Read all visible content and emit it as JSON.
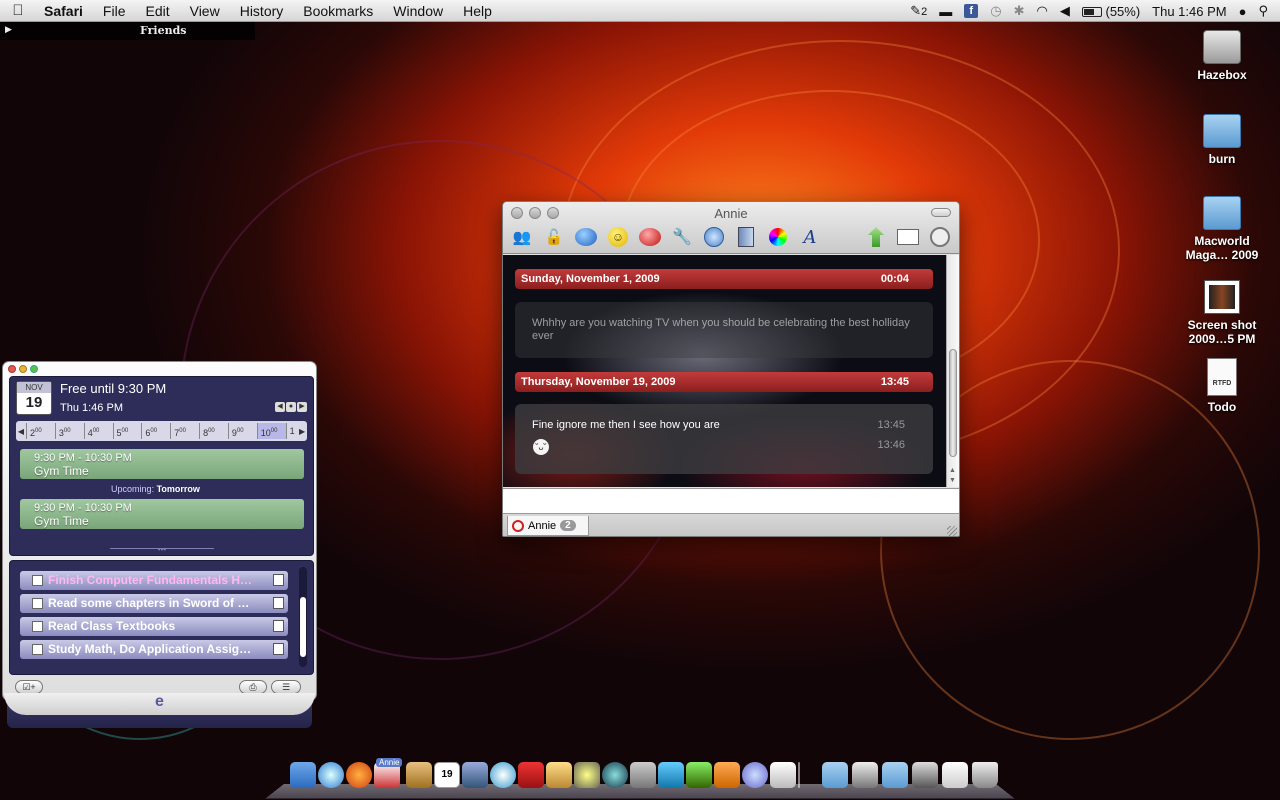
{
  "menubar": {
    "app_name": "Safari",
    "menus": [
      "File",
      "Edit",
      "View",
      "History",
      "Bookmarks",
      "Window",
      "Help"
    ],
    "status_badge": "2",
    "battery": "(55%)",
    "clock": "Thu 1:46 PM"
  },
  "friends_bar": {
    "label": "Friends"
  },
  "desktop_icons": [
    {
      "label": "Hazebox",
      "icon": "hard-drive-icon"
    },
    {
      "label": "burn",
      "icon": "folder-icon"
    },
    {
      "label": "Macworld Maga… 2009",
      "icon": "folder-icon"
    },
    {
      "label": "Screen shot 2009…5 PM",
      "icon": "screenshot-icon"
    },
    {
      "label": "Todo",
      "icon": "rtfd-document-icon",
      "badge": "RTFD"
    }
  ],
  "chat": {
    "title": "Annie",
    "sections": [
      {
        "date": "Sunday, November 1, 2009",
        "time": "00:04",
        "messages": [
          {
            "text": "Whhhy are you watching TV when you should be celebrating the best holliday ever",
            "timestamp": ""
          }
        ]
      },
      {
        "date": "Thursday, November 19, 2009",
        "time": "13:45",
        "messages": [
          {
            "text": "Fine ignore me then I see how you are",
            "timestamp": "13:45"
          },
          {
            "text": "",
            "timestamp": "13:46"
          }
        ]
      }
    ],
    "tab": {
      "name": "Annie",
      "unread": "2"
    }
  },
  "calendar_widget": {
    "month": "NOV",
    "day": "19",
    "free_status": "Free until 9:30 PM",
    "current": "Thu 1:46 PM",
    "timeline_hours": [
      "2",
      "3",
      "4",
      "5",
      "6",
      "7",
      "8",
      "9",
      "10",
      "1"
    ],
    "timeline_suffix": "00",
    "events": [
      {
        "time": "9:30 PM - 10:30 PM",
        "title": "Gym Time"
      },
      {
        "time": "9:30 PM - 10:30 PM",
        "title": "Gym Time"
      }
    ],
    "upcoming_prefix": "Upcoming:",
    "upcoming_value": "Tomorrow",
    "divider": "•••",
    "todos": [
      {
        "text": "Finish Computer Fundamentals H…",
        "highlight": true
      },
      {
        "text": "Read some chapters in Sword of …",
        "highlight": false
      },
      {
        "text": "Read Class Textbooks",
        "highlight": false
      },
      {
        "text": "Study Math, Do Application Assig…",
        "highlight": false
      }
    ],
    "logo": "e"
  },
  "dock": {
    "items": [
      "finder",
      "safari",
      "firefox",
      "adium",
      "address-book",
      "ical",
      "iphoto",
      "itunes",
      "pdf",
      "preview",
      "imovie",
      "time-machine",
      "system-preferences",
      "app-w",
      "app-y",
      "app-p",
      "app-e",
      "documents",
      "applications",
      "downloads",
      "folder",
      "screens",
      "keyboard",
      "trash"
    ],
    "adium_label": "Annie",
    "ical_date": "19"
  }
}
